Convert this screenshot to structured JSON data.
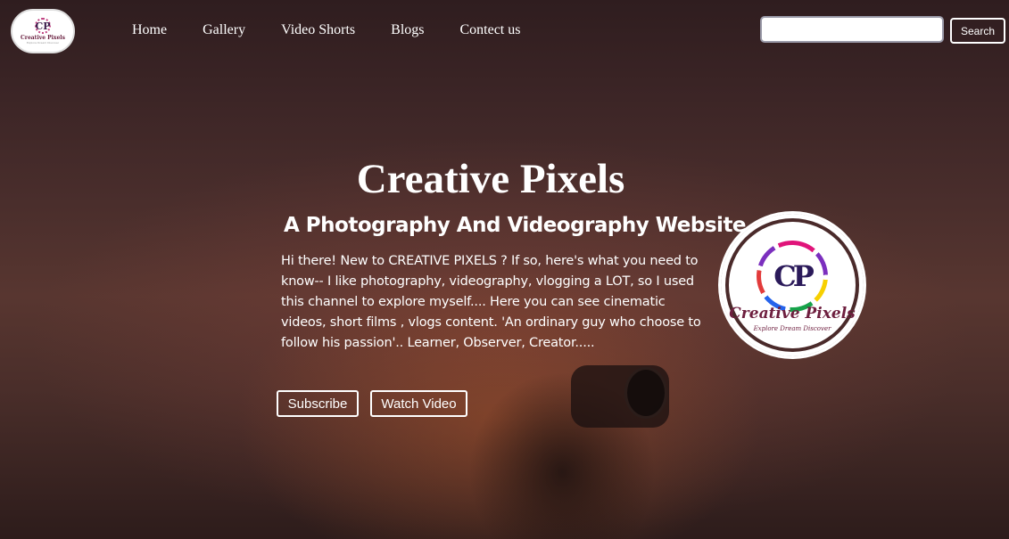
{
  "header": {
    "logo": {
      "brand": "Creative Pixels",
      "monogram": "CP",
      "tagline": "Explore Dream Discover"
    },
    "nav": [
      {
        "label": "Home"
      },
      {
        "label": "Gallery"
      },
      {
        "label": "Video Shorts"
      },
      {
        "label": "Blogs"
      },
      {
        "label": "Contect us"
      }
    ],
    "search": {
      "value": "",
      "placeholder": "",
      "button_label": "Search"
    }
  },
  "hero": {
    "title": "Creative Pixels",
    "subtitle": "A Photography And Videography Website",
    "text": "Hi there! New to CREATIVE PIXELS ? If so, here's what you need to know-- I like photography, videography, vlogging a LOT, so I used this channel to explore myself.... Here you can see cinematic videos, short films , vlogs content. 'An ordinary guy who choose to follow his passion'.. Learner, Observer, Creator.....",
    "buttons": {
      "subscribe": "Subscribe",
      "watch": "Watch Video"
    },
    "logo": {
      "monogram": "CP",
      "brand": "Creative Pixels",
      "tagline": "Explore Dream Discover"
    }
  },
  "colors": {
    "text": "#ffffff",
    "background": "#3c2526",
    "logo_accent": "#6e1f3f"
  }
}
